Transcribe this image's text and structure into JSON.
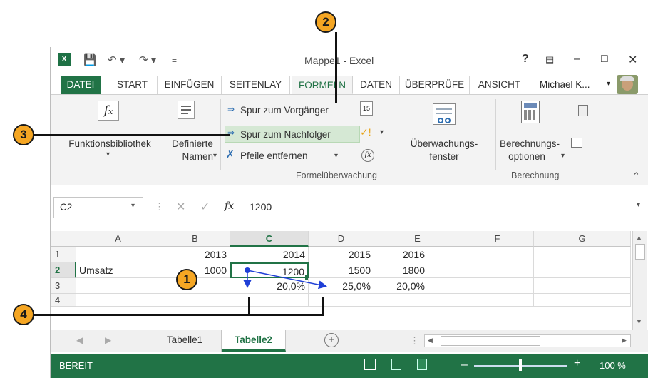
{
  "window": {
    "title": "Mappe1 - Excel",
    "help": "?",
    "user": "Michael K..."
  },
  "tabs": [
    "DATEI",
    "START",
    "EINFÜGEN",
    "SEITENLAY",
    "FORMELN",
    "DATEN",
    "ÜBERPRÜFE",
    "ANSICHT"
  ],
  "ribbon": {
    "funktionsbibliothek": "Funktionsbibliothek",
    "definierte": "Definierte",
    "namen": "Namen",
    "spur_vorgaenger": "Spur zum Vorgänger",
    "spur_nachfolger": "Spur zum Nachfolger",
    "pfeile_entfernen": "Pfeile entfernen",
    "ueberwachung1": "Überwachungs-",
    "ueberwachung2": "fenster",
    "berechnung1": "Berechnungs-",
    "berechnung2": "optionen",
    "group_formel": "Formelüberwachung",
    "group_berechnung": "Berechnung"
  },
  "formula_bar": {
    "namebox": "C2",
    "fx": "fx",
    "value": "1200"
  },
  "columns": [
    "A",
    "B",
    "C",
    "D",
    "E",
    "F",
    "G"
  ],
  "rows": [
    {
      "n": "1",
      "A": "",
      "B": "2013",
      "C": "2014",
      "D": "2015",
      "E": "2016"
    },
    {
      "n": "2",
      "A": "Umsatz",
      "B": "1000",
      "C": "1200",
      "D": "1500",
      "E": "1800"
    },
    {
      "n": "3",
      "A": "",
      "B": "",
      "C": "20,0%",
      "D": "25,0%",
      "E": "20,0%"
    },
    {
      "n": "4",
      "A": "",
      "B": "",
      "C": "",
      "D": "",
      "E": ""
    }
  ],
  "sheets": [
    "Tabelle1",
    "Tabelle2"
  ],
  "status": {
    "mode": "BEREIT",
    "zoom": "100 %"
  },
  "callouts": [
    "1",
    "2",
    "3",
    "4"
  ],
  "colors": {
    "excel_green": "#217346",
    "callout": "#f5a623"
  }
}
